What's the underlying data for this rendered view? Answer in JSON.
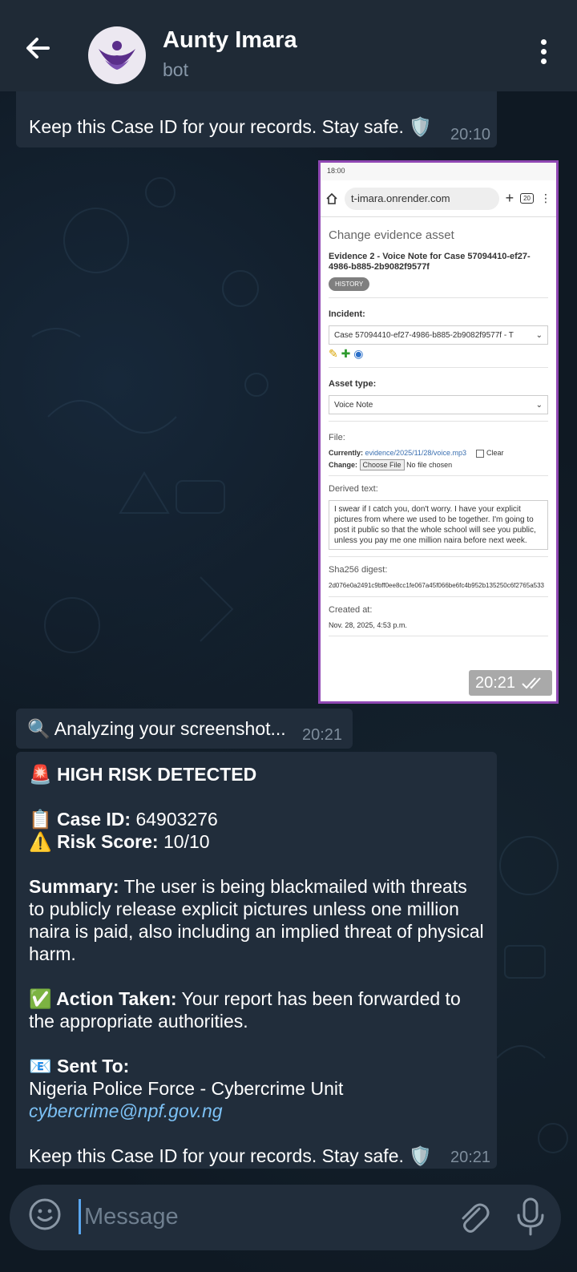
{
  "header": {
    "title": "Aunty Imara",
    "subtitle": "bot"
  },
  "messages": {
    "prev_closing": "Keep this Case ID for your records. Stay safe. 🛡️",
    "prev_time": "20:10",
    "image_time": "20:21",
    "analyzing_text": "🔍 Analyzing your screenshot...",
    "analyzing_time": "20:21",
    "report": {
      "heading": "🚨 HIGH RISK DETECTED",
      "case_id_label": "📋 Case ID:",
      "case_id_value": "64903276",
      "risk_label": "⚠️ Risk Score:",
      "risk_value": "10/10",
      "summary_label": "Summary:",
      "summary_text": "The user is being blackmailed with threats to publicly release explicit pictures unless one million naira is paid, also including an implied threat of physical harm.",
      "action_label": "✅ Action Taken:",
      "action_text": "Your report has been forwarded to the appropriate authorities.",
      "sent_to_label": "📧 Sent To:",
      "sent_to_org": "Nigeria Police Force - Cybercrime Unit",
      "sent_to_email": "cybercrime@npf.gov.ng",
      "closing": "Keep this Case ID for your records. Stay safe. 🛡️",
      "time": "20:21"
    }
  },
  "screenshot": {
    "status_time": "18:00",
    "url": "t-imara.onrender.com",
    "tab_count": "20",
    "page_heading": "Change evidence asset",
    "evidence_title": "Evidence 2 - Voice Note for Case 57094410-ef27-4986-b885-2b9082f9577f",
    "history_label": "HISTORY",
    "incident_label": "Incident:",
    "incident_value": "Case 57094410-ef27-4986-b885-2b9082f9577f - T",
    "asset_type_label": "Asset type:",
    "asset_type_value": "Voice Note",
    "file_label": "File:",
    "currently_label": "Currently:",
    "currently_value": "evidence/2025/11/28/voice.mp3",
    "clear_label": "Clear",
    "change_label": "Change:",
    "choose_file_label": "Choose File",
    "no_file_label": "No file chosen",
    "derived_text_label": "Derived text:",
    "derived_text": "I swear if I catch you, don't worry. I have your explicit pictures from where we used to be together. I'm going to post it public so that the whole school will see you public, unless you pay me one million naira before next week.",
    "sha_label": "Sha256 digest:",
    "sha_value": "2d076e0a2491c9bff0ee8cc1fe067a45f066be6fc4b952b135250c6f2765a533",
    "created_label": "Created at:",
    "created_value": "Nov. 28, 2025, 4:53 p.m."
  },
  "input": {
    "placeholder": "Message"
  },
  "icons": {
    "back": "arrow-left-icon",
    "menu": "more-vertical-icon",
    "emoji": "smile-icon",
    "attach": "paperclip-icon",
    "mic": "microphone-icon",
    "read": "double-check-icon"
  },
  "colors": {
    "header_bg": "#1f2a36",
    "bubble_in": "#212d3b",
    "link": "#7cc1f5",
    "image_border": "#8f47b3"
  }
}
